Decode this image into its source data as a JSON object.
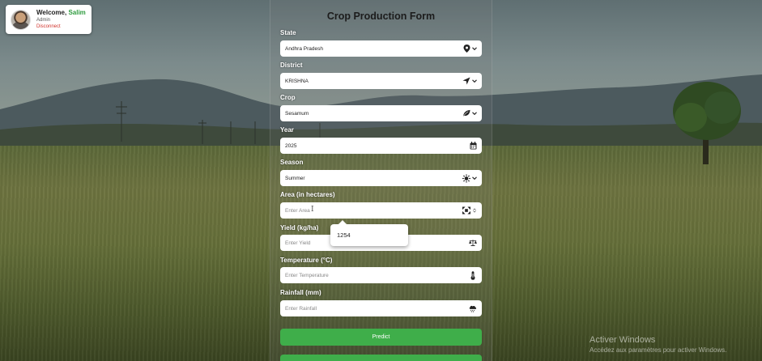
{
  "user": {
    "welcome_prefix": "Welcome,",
    "name": "Salim",
    "role": "Admin",
    "disconnect_label": "Disconnect"
  },
  "form": {
    "title": "Crop Production Form",
    "state": {
      "label": "State",
      "value": "Andhra Pradesh",
      "icon": "map-pin-icon"
    },
    "district": {
      "label": "District",
      "value": "KRISHNA",
      "icon": "location-arrow-icon"
    },
    "crop": {
      "label": "Crop",
      "value": "Sesamum",
      "icon": "leaf-icon"
    },
    "year": {
      "label": "Year",
      "value": "2025",
      "icon": "calendar-icon"
    },
    "season": {
      "label": "Season",
      "value": "Summer",
      "icon": "sun-icon"
    },
    "area": {
      "label": "Area (in hectares)",
      "placeholder": "Enter Area",
      "icon": "area-expand-icon"
    },
    "area_suggestion": "1254",
    "yield": {
      "label": "Yield (kg/ha)",
      "placeholder": "Enter Yield",
      "icon": "scale-icon"
    },
    "temperature": {
      "label": "Temperature (°C)",
      "placeholder": "Enter Temperature",
      "icon": "thermometer-icon"
    },
    "rainfall": {
      "label": "Rainfall (mm)",
      "placeholder": "Enter Rainfall",
      "icon": "rain-cloud-icon"
    },
    "predict_label": "Predict"
  },
  "watermark": {
    "line1": "Activer Windows",
    "line2": "Accédez aux paramètres pour activer Windows."
  },
  "colors": {
    "accent_green": "#3fae4a",
    "disconnect_red": "#d0342c",
    "name_green": "#2e9b3e"
  }
}
